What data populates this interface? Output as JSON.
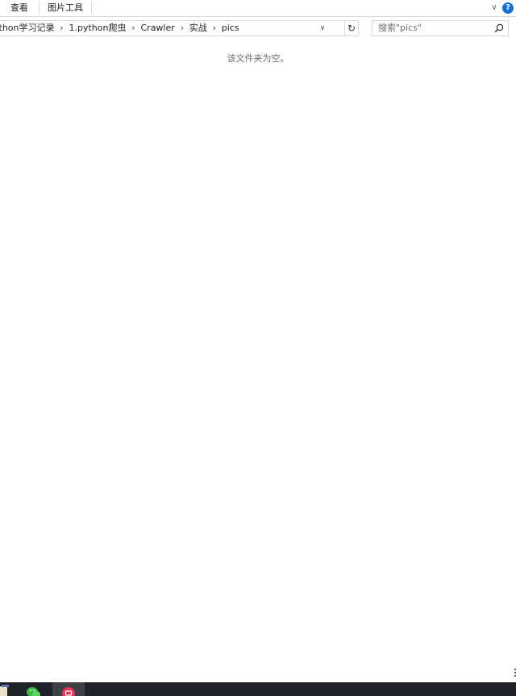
{
  "ribbon": {
    "tabs": [
      {
        "label": "查看"
      },
      {
        "label": "图片工具"
      }
    ],
    "expand_glyph": "∨",
    "help_glyph": "?"
  },
  "address": {
    "crumbs": [
      "ython学习记录",
      "1.python爬虫",
      "Crawler",
      "实战",
      "pics"
    ],
    "separator": "›",
    "dropdown_glyph": "∨",
    "refresh_glyph": "↻"
  },
  "search": {
    "placeholder": "搜索\"pics\"",
    "value": ""
  },
  "content": {
    "empty_message": "该文件夹为空。"
  },
  "colors": {
    "accent": "#1a6fd1",
    "taskbar": "#1f2226",
    "selected_view": "#cce4f7"
  }
}
